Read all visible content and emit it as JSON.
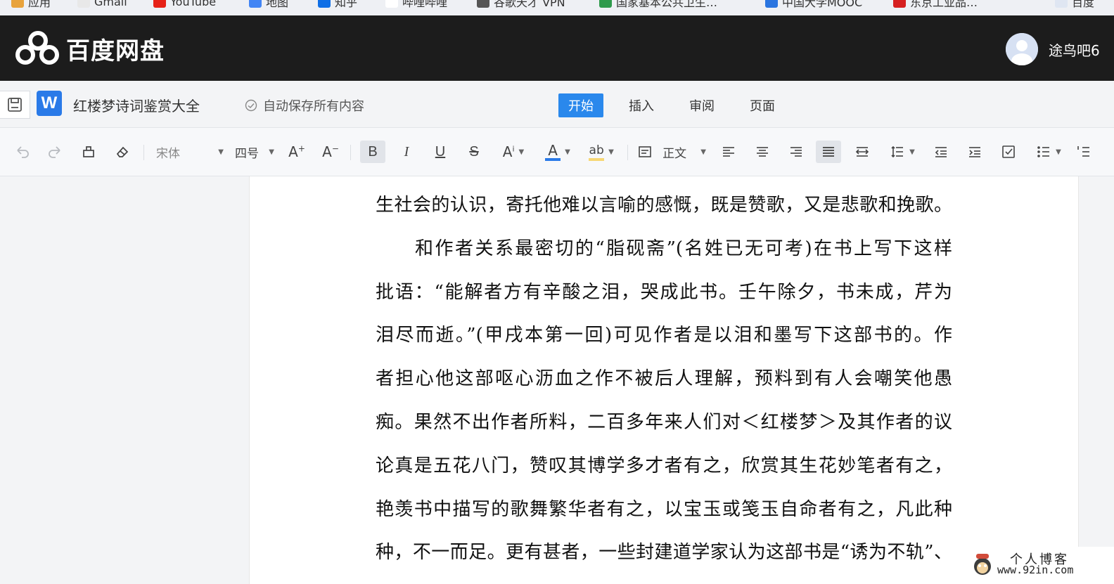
{
  "bookmarks": [
    {
      "label": "应用",
      "color": "#e8a33c"
    },
    {
      "label": "Gmail",
      "color": "#e8e8e8"
    },
    {
      "label": "YouTube",
      "color": "#e62117"
    },
    {
      "label": "地图",
      "color": "#4285f4"
    },
    {
      "label": "知乎",
      "color": "#0f6fe6"
    },
    {
      "label": "哔哩哔哩",
      "color": "#ffffff"
    },
    {
      "label": "谷歌天才 VPN",
      "color": "#555555"
    },
    {
      "label": "国家基本公共卫生…",
      "color": "#2e9a4c"
    },
    {
      "label": "中国大学MOOC",
      "color": "#2a75e0"
    },
    {
      "label": "东京工业品…",
      "color": "#d62020"
    },
    {
      "label": "百度",
      "color": "#dfe6f2"
    }
  ],
  "app": {
    "brand": "百度网盘",
    "username": "途鸟吧6"
  },
  "document": {
    "title": "红楼梦诗词鉴赏大全",
    "autosave": "自动保存所有内容",
    "wps_badge": "W"
  },
  "tabs": [
    {
      "label": "开始",
      "active": true
    },
    {
      "label": "插入",
      "active": false
    },
    {
      "label": "审阅",
      "active": false
    },
    {
      "label": "页面",
      "active": false
    }
  ],
  "toolbar": {
    "font_family": "宋体",
    "font_size": "四号",
    "paragraph_style": "正文",
    "bold": "B",
    "italic": "I",
    "underline": "U",
    "strike": "S",
    "font_color_letter": "A",
    "font_color": "#2a7ae8",
    "highlight_letter": "ab",
    "highlight_color": "#f7d774"
  },
  "content": {
    "lines": [
      {
        "text": "生社会的认识，寄托他难以言喻的感慨，既是赞歌，又是悲歌和挽歌。",
        "indent": false
      },
      {
        "text": "和作者关系最密切的“脂砚斋”(名姓已无可考)在书上写下这样",
        "indent": true
      },
      {
        "text": "批语：“能解者方有辛酸之泪，哭成此书。壬午除夕，书未成，芹为",
        "indent": false
      },
      {
        "text": "泪尽而逝。”(甲戌本第一回)可见作者是以泪和墨写下这部书的。作",
        "indent": false
      },
      {
        "text": "者担心他这部呕心沥血之作不被后人理解，预料到有人会嘲笑他愚",
        "indent": false
      },
      {
        "text": "痴。果然不出作者所料，二百多年来人们对＜红楼梦＞及其作者的议",
        "indent": false
      },
      {
        "text": "论真是五花八门，赞叹其博学多才者有之，欣赏其生花妙笔者有之，",
        "indent": false
      },
      {
        "text": "艳羡书中描写的歌舞繁华者有之，以宝玉或笺玉自命者有之，凡此种",
        "indent": false
      },
      {
        "text": "种，不一而足。更有甚者，一些封建道学家认为这部书是“诱为不轨”、",
        "indent": false
      }
    ]
  },
  "watermark": {
    "line1": "个人博客",
    "line2": "www.92in.com"
  }
}
